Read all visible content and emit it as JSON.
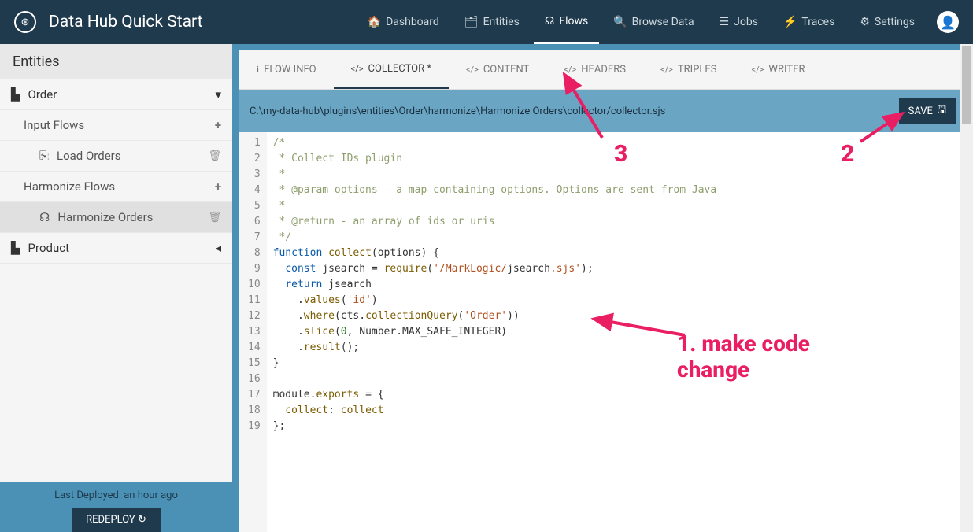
{
  "app": {
    "title": "Data Hub Quick Start"
  },
  "nav": {
    "dashboard": "Dashboard",
    "entities": "Entities",
    "flows": "Flows",
    "browse": "Browse Data",
    "jobs": "Jobs",
    "traces": "Traces",
    "settings": "Settings"
  },
  "sidebar": {
    "title": "Entities",
    "order": "Order",
    "inputFlows": "Input Flows",
    "loadOrders": "Load Orders",
    "harmonizeFlows": "Harmonize Flows",
    "harmonizeOrders": "Harmonize Orders",
    "product": "Product",
    "lastDeployed": "Last Deployed: an hour ago",
    "redeploy": "REDEPLOY"
  },
  "tabs": {
    "flowInfo": "FLOW INFO",
    "collector": "COLLECTOR *",
    "content": "CONTENT",
    "headers": "HEADERS",
    "triples": "TRIPLES",
    "writer": "WRITER"
  },
  "pathbar": {
    "path": "C:\\my-data-hub\\plugins\\entities\\Order\\harmonize\\Harmonize Orders\\collector/collector.sjs",
    "save": "SAVE"
  },
  "code": {
    "lines": [
      "/*",
      " * Collect IDs plugin",
      " *",
      " * @param options - a map containing options. Options are sent from Java",
      " *",
      " * @return - an array of ids or uris",
      " */",
      "function collect(options) {",
      "  const jsearch = require('/MarkLogic/jsearch.sjs');",
      "  return jsearch",
      "    .values('id')",
      "    .where(cts.collectionQuery('Order'))",
      "    .slice(0, Number.MAX_SAFE_INTEGER)",
      "    .result();",
      "}",
      "",
      "module.exports = {",
      "  collect: collect",
      "};"
    ]
  },
  "annotations": {
    "n1": "1. make code change",
    "n2": "2",
    "n3": "3"
  }
}
